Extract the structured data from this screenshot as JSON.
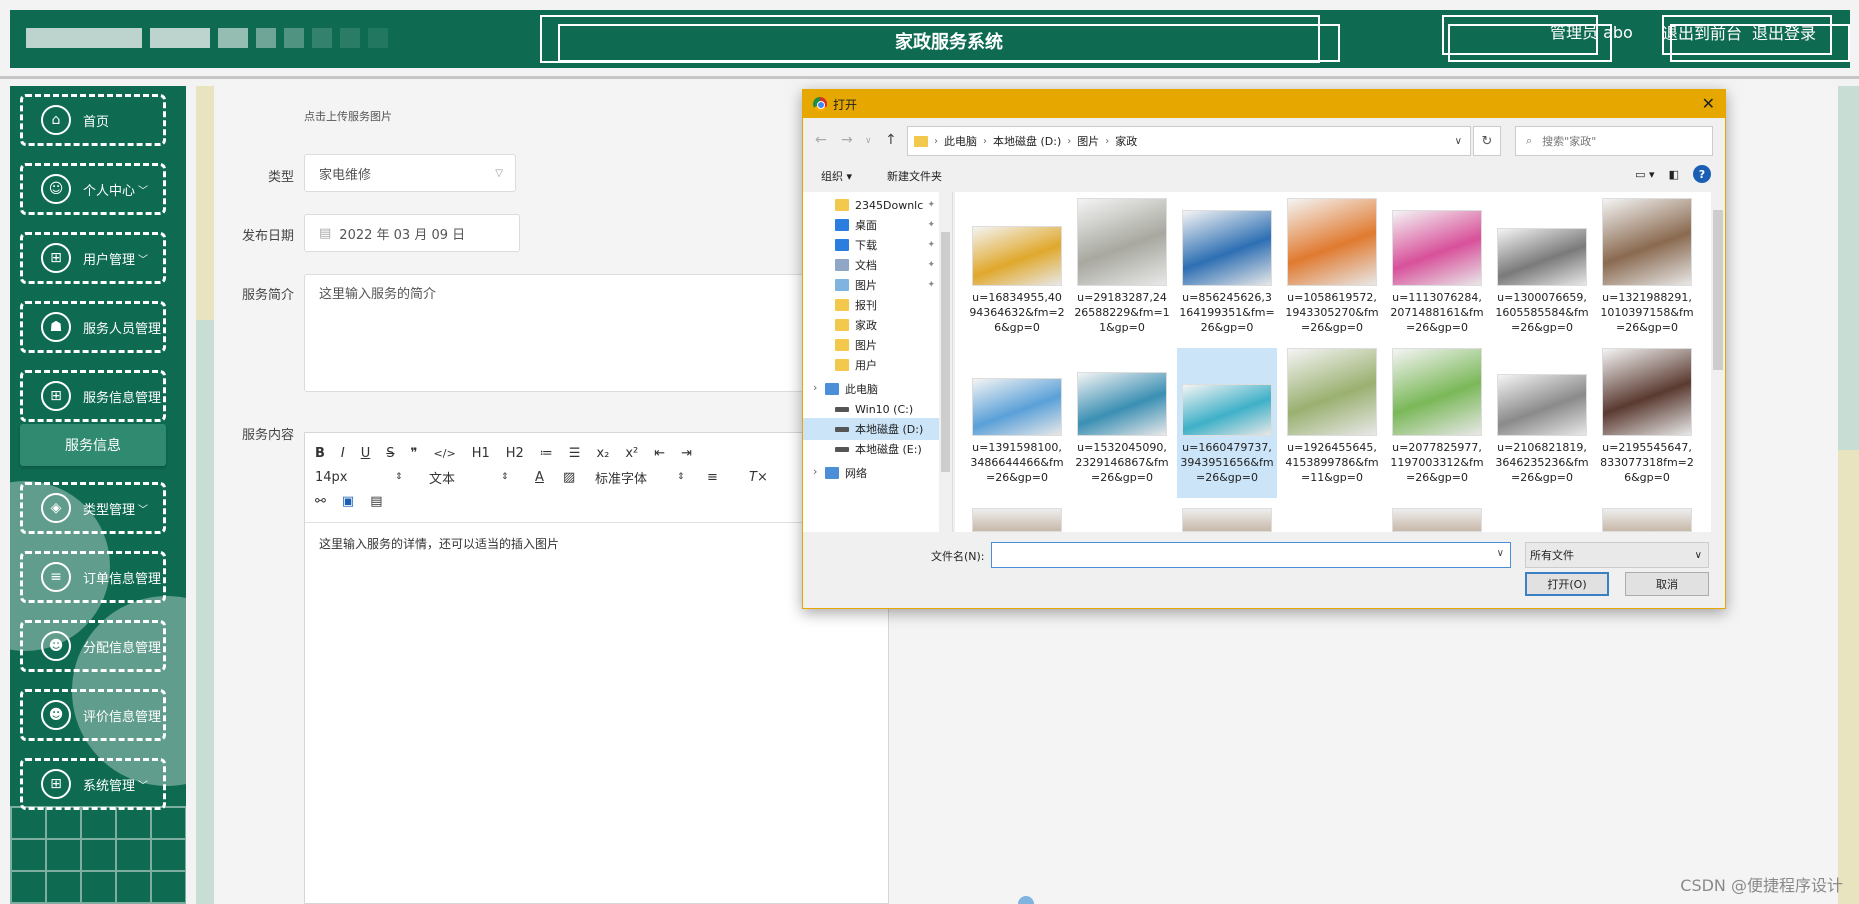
{
  "header": {
    "title": "家政服务系统",
    "admin_label": "管理员 abo",
    "nav_front": "退出到前台",
    "nav_logout": "退出登录"
  },
  "sidebar": {
    "items": [
      {
        "label": "首页",
        "icon": "home-icon"
      },
      {
        "label": "个人中心",
        "icon": "user-icon",
        "chevron": "﹀"
      },
      {
        "label": "用户管理",
        "icon": "grid-icon",
        "chevron": "﹀"
      },
      {
        "label": "服务人员管理",
        "icon": "worker-icon",
        "chevron": ""
      },
      {
        "label": "服务信息管理",
        "icon": "grid-icon",
        "chevron": ""
      },
      {
        "label": "类型管理",
        "icon": "tag-icon",
        "chevron": "﹀"
      },
      {
        "label": "订单信息管理",
        "icon": "order-icon",
        "chevron": ""
      },
      {
        "label": "分配信息管理",
        "icon": "person-icon",
        "chevron": ""
      },
      {
        "label": "评价信息管理",
        "icon": "person-icon",
        "chevron": ""
      },
      {
        "label": "系统管理",
        "icon": "grid-icon",
        "chevron": "﹀"
      }
    ],
    "submenu_active": "服务信息"
  },
  "form": {
    "upload_hint": "点击上传服务图片",
    "type_label": "类型",
    "type_value": "家电维修",
    "date_label": "发布日期",
    "date_value": "2022 年 03 月 09 日",
    "intro_label": "服务简介",
    "intro_placeholder": "这里输入服务的简介",
    "content_label": "服务内容",
    "editor": {
      "row1": [
        "B",
        "I",
        "U",
        "S",
        "❞",
        "</>",
        "H1",
        "H2",
        "≔",
        "☰",
        "x₂",
        "x²",
        "⇤",
        "⇥"
      ],
      "font_size": "14px",
      "text_style": "文本",
      "font_family": "标准字体",
      "content_placeholder": "这里输入服务的详情，还可以适当的插入图片"
    }
  },
  "dialog": {
    "title": "打开",
    "breadcrumb": [
      "此电脑",
      "本地磁盘 (D:)",
      "图片",
      "家政"
    ],
    "search_placeholder": "搜索\"家政\"",
    "organize": "组织 ▾",
    "new_folder": "新建文件夹",
    "nav_items": [
      {
        "label": "2345Downlc",
        "kind": "folder",
        "pinned": true
      },
      {
        "label": "桌面",
        "kind": "desktop",
        "pinned": true
      },
      {
        "label": "下载",
        "kind": "download",
        "pinned": true
      },
      {
        "label": "文档",
        "kind": "doc",
        "pinned": true
      },
      {
        "label": "图片",
        "kind": "pic",
        "pinned": true
      },
      {
        "label": "报刊",
        "kind": "folder",
        "pinned": false
      },
      {
        "label": "家政",
        "kind": "folder",
        "pinned": false
      },
      {
        "label": "图片",
        "kind": "folder",
        "pinned": false
      },
      {
        "label": "用户",
        "kind": "folder",
        "pinned": false
      },
      {
        "label": "此电脑",
        "kind": "pc",
        "pinned": false
      },
      {
        "label": "Win10 (C:)",
        "kind": "drive",
        "pinned": false
      },
      {
        "label": "本地磁盘 (D:)",
        "kind": "drive",
        "pinned": false,
        "selected": true
      },
      {
        "label": "本地磁盘 (E:)",
        "kind": "drive",
        "pinned": false
      },
      {
        "label": "网络",
        "kind": "network",
        "pinned": false
      }
    ],
    "files": [
      {
        "name": "u=16834955,4094364632&fm=26&gp=0",
        "color": "#e0a82c",
        "h": 60
      },
      {
        "name": "u=29183287,2426588229&fm=11&gp=0",
        "color": "#a8a8a0",
        "h": 88
      },
      {
        "name": "u=856245626,3164199351&fm=26&gp=0",
        "color": "#2d6fb3",
        "h": 76
      },
      {
        "name": "u=1058619572,1943305270&fm=26&gp=0",
        "color": "#e07a30",
        "h": 88
      },
      {
        "name": "u=1113076284,2071488161&fm=26&gp=0",
        "color": "#d8509a",
        "h": 76
      },
      {
        "name": "u=1300076659,1605585584&fm=26&gp=0",
        "color": "#7a7a7a",
        "h": 58
      },
      {
        "name": "u=1321988291,1010397158&fm=26&gp=0",
        "color": "#8a6a50",
        "h": 88
      },
      {
        "name": "u=1391598100,3486644466&fm=26&gp=0",
        "color": "#5aa0d8",
        "h": 58
      },
      {
        "name": "u=1532045090,2329146867&fm=26&gp=0",
        "color": "#3a8fb3",
        "h": 64
      },
      {
        "name": "u=1660479737,3943951656&fm=26&gp=0",
        "color": "#3fb0c8",
        "h": 52
      },
      {
        "name": "u=1926455645,4153899786&fm=11&gp=0",
        "color": "#9ab070",
        "h": 88
      },
      {
        "name": "u=2077825977,1197003312&fm=26&gp=0",
        "color": "#7ab858",
        "h": 88
      },
      {
        "name": "u=2106821819,3646235236&fm=26&gp=0",
        "color": "#8a8a8a",
        "h": 62
      },
      {
        "name": "u=2195545647,833077318fm=26&gp=0",
        "color": "#5a3a30",
        "h": 88
      }
    ],
    "filename_label": "文件名(N):",
    "filetype": "所有文件",
    "open_btn": "打开(O)",
    "cancel_btn": "取消"
  },
  "watermark": "CSDN @便捷程序设计"
}
